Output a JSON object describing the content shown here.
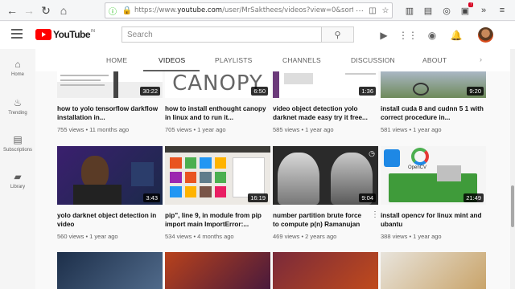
{
  "browser": {
    "url_prefix": "https://www.",
    "url_domain": "youtube.com",
    "url_rest": "/user/MrSakthees/videos?view=0&sort=p&flow"
  },
  "header": {
    "logo_text": "YouTube",
    "logo_country": "IN",
    "search_placeholder": "Search"
  },
  "guide": {
    "items": [
      {
        "label": "Home",
        "icon": "home-icon"
      },
      {
        "label": "Trending",
        "icon": "flame-icon"
      },
      {
        "label": "Subscriptions",
        "icon": "subscriptions-icon"
      },
      {
        "label": "Library",
        "icon": "folder-icon"
      }
    ]
  },
  "tabs": [
    {
      "label": "HOME"
    },
    {
      "label": "VIDEOS"
    },
    {
      "label": "PLAYLISTS"
    },
    {
      "label": "CHANNELS"
    },
    {
      "label": "DISCUSSION"
    },
    {
      "label": "ABOUT"
    }
  ],
  "videos": [
    {
      "title": "how to yolo tensorflow darkflow installation in...",
      "views": "755 views",
      "age": "11 months ago",
      "duration": "30:22"
    },
    {
      "title": "how to install enthought canopy in linux and to run it...",
      "views": "705 views",
      "age": "1 year ago",
      "duration": "6:50",
      "thumb_text": "CANOPY"
    },
    {
      "title": "object detection yolo darknet made easy try it free...",
      "views": "585 views",
      "age": "1 year ago",
      "duration": "1:36",
      "title_prefix": "video "
    },
    {
      "title": "install cuda 8 and cudnn 5 1 with correct procedure in...",
      "views": "581 views",
      "age": "1 year ago",
      "duration": "9:20"
    },
    {
      "title": "yolo darknet object detection in video",
      "views": "560 views",
      "age": "1 year ago",
      "duration": "3:43"
    },
    {
      "title": "pip\", line 9, in module from pip import main ImportError:...",
      "views": "534 views",
      "age": "4 months ago",
      "duration": "16:19"
    },
    {
      "title": "number partition brute force to compute p(n) Ramanujan",
      "views": "469 views",
      "age": "2 years ago",
      "duration": "9:04"
    },
    {
      "title": "install opencv for linux mint and ubantu",
      "views": "388 views",
      "age": "1 year ago",
      "duration": "21:49",
      "thumb_text": "OpenCV"
    }
  ]
}
